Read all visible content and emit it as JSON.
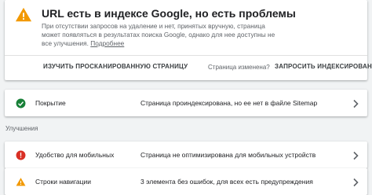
{
  "issue": {
    "title": "URL есть в индексе Google, но есть проблемы",
    "description": "При отсутствии запросов на удаление и нет, принятых вручную, страница может появляться в результатах поиска Google, однако для нее доступны не все улучшения.",
    "more_link": "Подробнее",
    "inspect_button": "ИЗУЧИТЬ ПРОСКАНИРОВАННУЮ СТРАНИЦУ",
    "changed_text": "Страница изменена?",
    "request_button": "ЗАПРОСИТЬ ИНДЕКСИРОВАНИЕ",
    "icon": "warning-icon"
  },
  "coverage": {
    "label": "Покрытие",
    "status": "Страница проиндексирована, но ее нет в файле Sitemap",
    "icon": "check-circle-icon"
  },
  "enhancements": {
    "section_label": "Улучшения",
    "items": [
      {
        "label": "Удобство для мобильных",
        "status": "Страница не оптимизирована для мобильных устройств",
        "icon": "error-circle-icon"
      },
      {
        "label": "Строки навигации",
        "status": "3 элемента без ошибок, для всех есть предупреждения",
        "icon": "warning-icon"
      }
    ]
  },
  "colors": {
    "warning": "#f29900",
    "success": "#188038",
    "error": "#d93025",
    "background": "#f1f3f4"
  }
}
